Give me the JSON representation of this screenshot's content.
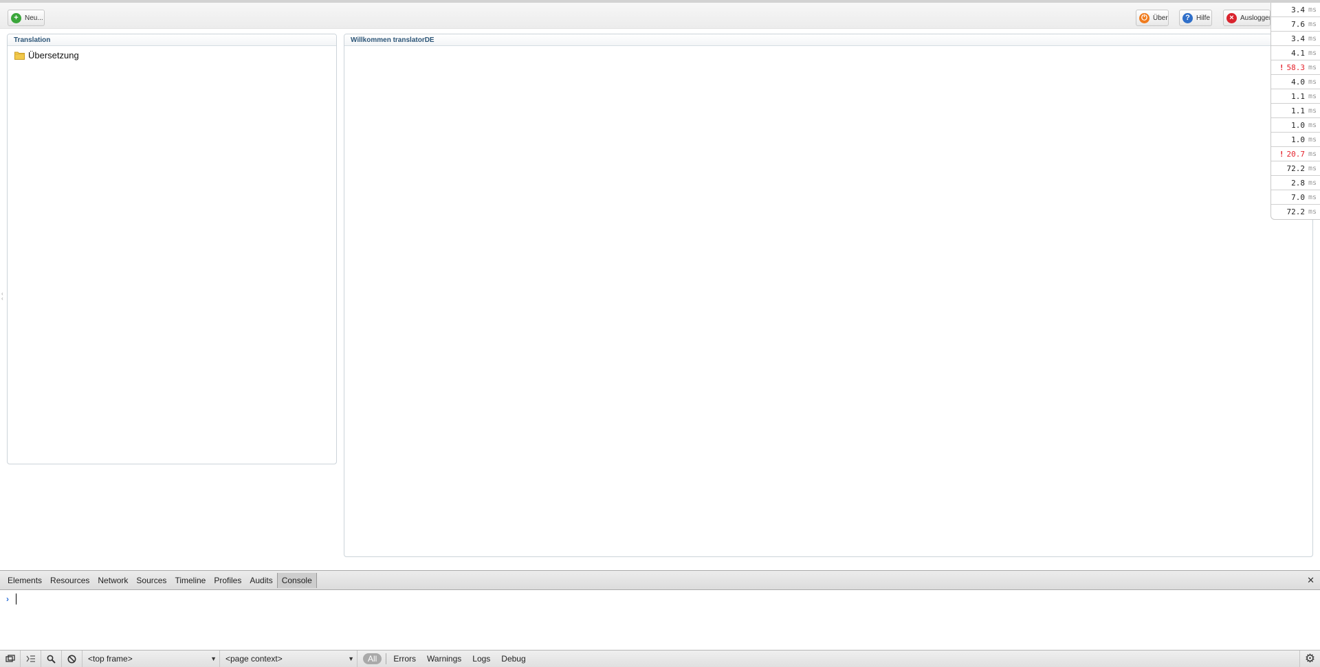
{
  "toolbar": {
    "new_label": "Neu...",
    "about_label": "Über",
    "help_label": "Hilfe",
    "logout_label": "Ausloggen"
  },
  "left_panel": {
    "title": "Translation",
    "tree_items": [
      {
        "label": "Übersetzung",
        "icon": "folder-icon"
      }
    ]
  },
  "main_panel": {
    "title": "Willkommen translatorDE"
  },
  "timings": [
    {
      "value": "3.4",
      "unit": "ms",
      "warn": false
    },
    {
      "value": "7.6",
      "unit": "ms",
      "warn": false
    },
    {
      "value": "3.4",
      "unit": "ms",
      "warn": false
    },
    {
      "value": "4.1",
      "unit": "ms",
      "warn": false
    },
    {
      "value": "58.3",
      "unit": "ms",
      "warn": true
    },
    {
      "value": "4.0",
      "unit": "ms",
      "warn": false
    },
    {
      "value": "1.1",
      "unit": "ms",
      "warn": false
    },
    {
      "value": "1.1",
      "unit": "ms",
      "warn": false
    },
    {
      "value": "1.0",
      "unit": "ms",
      "warn": false
    },
    {
      "value": "1.0",
      "unit": "ms",
      "warn": false
    },
    {
      "value": "20.7",
      "unit": "ms",
      "warn": true
    },
    {
      "value": "72.2",
      "unit": "ms",
      "warn": false
    },
    {
      "value": "2.8",
      "unit": "ms",
      "warn": false
    },
    {
      "value": "7.0",
      "unit": "ms",
      "warn": false
    },
    {
      "value": "72.2",
      "unit": "ms",
      "warn": false
    }
  ],
  "timing_warn_mark": "!",
  "devtools": {
    "tabs": [
      "Elements",
      "Resources",
      "Network",
      "Sources",
      "Timeline",
      "Profiles",
      "Audits",
      "Console"
    ],
    "active_tab": "Console",
    "prompt_symbol": "›",
    "frame_select": "<top frame>",
    "context_select": "<page context>",
    "filters": [
      "All",
      "Errors",
      "Warnings",
      "Logs",
      "Debug"
    ],
    "active_filter": "All"
  },
  "colors": {
    "panel_title": "#2c5577",
    "warn": "#e4202a",
    "add_icon": "#3aa63a",
    "about_icon": "#f07b1d",
    "help_icon": "#2f6fc9",
    "logout_icon": "#d9232d"
  }
}
